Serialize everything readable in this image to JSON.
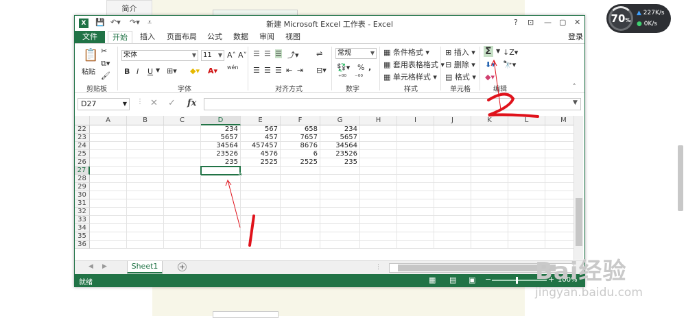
{
  "background": {
    "tab_label": "简介"
  },
  "net_widget": {
    "percent": "70",
    "percent_unit": "%",
    "up": "227K/s",
    "down": "0K/s"
  },
  "titlebar": {
    "logo": "X",
    "title": "新建 Microsoft Excel 工作表 - Excel",
    "help": "?",
    "minimize": "—",
    "restore": "▢",
    "close": "✕"
  },
  "tabs": {
    "file": "文件",
    "items": [
      "开始",
      "插入",
      "页面布局",
      "公式",
      "数据",
      "审阅",
      "视图"
    ],
    "active": "开始",
    "login": "登录"
  },
  "ribbon": {
    "clipboard": {
      "paste": "粘贴",
      "label": "剪贴板"
    },
    "font": {
      "name": "宋体",
      "size": "11",
      "grow": "A˄",
      "shrink": "A˅",
      "bold": "B",
      "italic": "I",
      "underline": "U",
      "wen": "wén",
      "label": "字体"
    },
    "alignment": {
      "label": "对齐方式"
    },
    "number": {
      "format": "常规",
      "percent": "%",
      "comma": ",",
      "label": "数字"
    },
    "styles": {
      "conditional": "条件格式",
      "table_format": "套用表格格式",
      "cell_styles": "单元格样式",
      "label": "样式"
    },
    "cells": {
      "insert": "插入",
      "delete": "删除",
      "format": "格式",
      "label": "单元格"
    },
    "editing": {
      "sum": "Σ",
      "label": "编辑"
    }
  },
  "formula_bar": {
    "name_box": "D27",
    "cancel": "✕",
    "enter": "✓",
    "fx": "fx",
    "content": ""
  },
  "columns": [
    "A",
    "B",
    "C",
    "D",
    "E",
    "F",
    "G",
    "H",
    "I",
    "J",
    "K",
    "L",
    "M"
  ],
  "selected_column": "D",
  "rows": [
    {
      "n": "22",
      "cells": {
        "D": "234",
        "E": "567",
        "F": "658",
        "G": "234"
      }
    },
    {
      "n": "23",
      "cells": {
        "D": "5657",
        "E": "457",
        "F": "7657",
        "G": "5657"
      }
    },
    {
      "n": "24",
      "cells": {
        "D": "34564",
        "E": "457457",
        "F": "8676",
        "G": "34564"
      }
    },
    {
      "n": "25",
      "cells": {
        "D": "23526",
        "E": "4576",
        "F": "6",
        "G": "23526"
      }
    },
    {
      "n": "26",
      "cells": {
        "D": "235",
        "E": "2525",
        "F": "2525",
        "G": "235"
      }
    },
    {
      "n": "27",
      "cells": {}
    },
    {
      "n": "28",
      "cells": {}
    },
    {
      "n": "29",
      "cells": {}
    },
    {
      "n": "30",
      "cells": {}
    },
    {
      "n": "31",
      "cells": {}
    },
    {
      "n": "32",
      "cells": {}
    },
    {
      "n": "33",
      "cells": {}
    },
    {
      "n": "34",
      "cells": {}
    },
    {
      "n": "35",
      "cells": {}
    },
    {
      "n": "36",
      "cells": {}
    }
  ],
  "selected_row": "27",
  "sheets": {
    "active": "Sheet1",
    "add": "+"
  },
  "status": {
    "ready": "就绪",
    "zoom": "100%"
  },
  "annotations": {
    "one": "1",
    "two": "2"
  },
  "watermark": {
    "brand": "Bai经验",
    "url": "jingyan.baidu.com"
  },
  "colors": {
    "excel_green": "#217346",
    "annotation_red": "#e0121b"
  }
}
